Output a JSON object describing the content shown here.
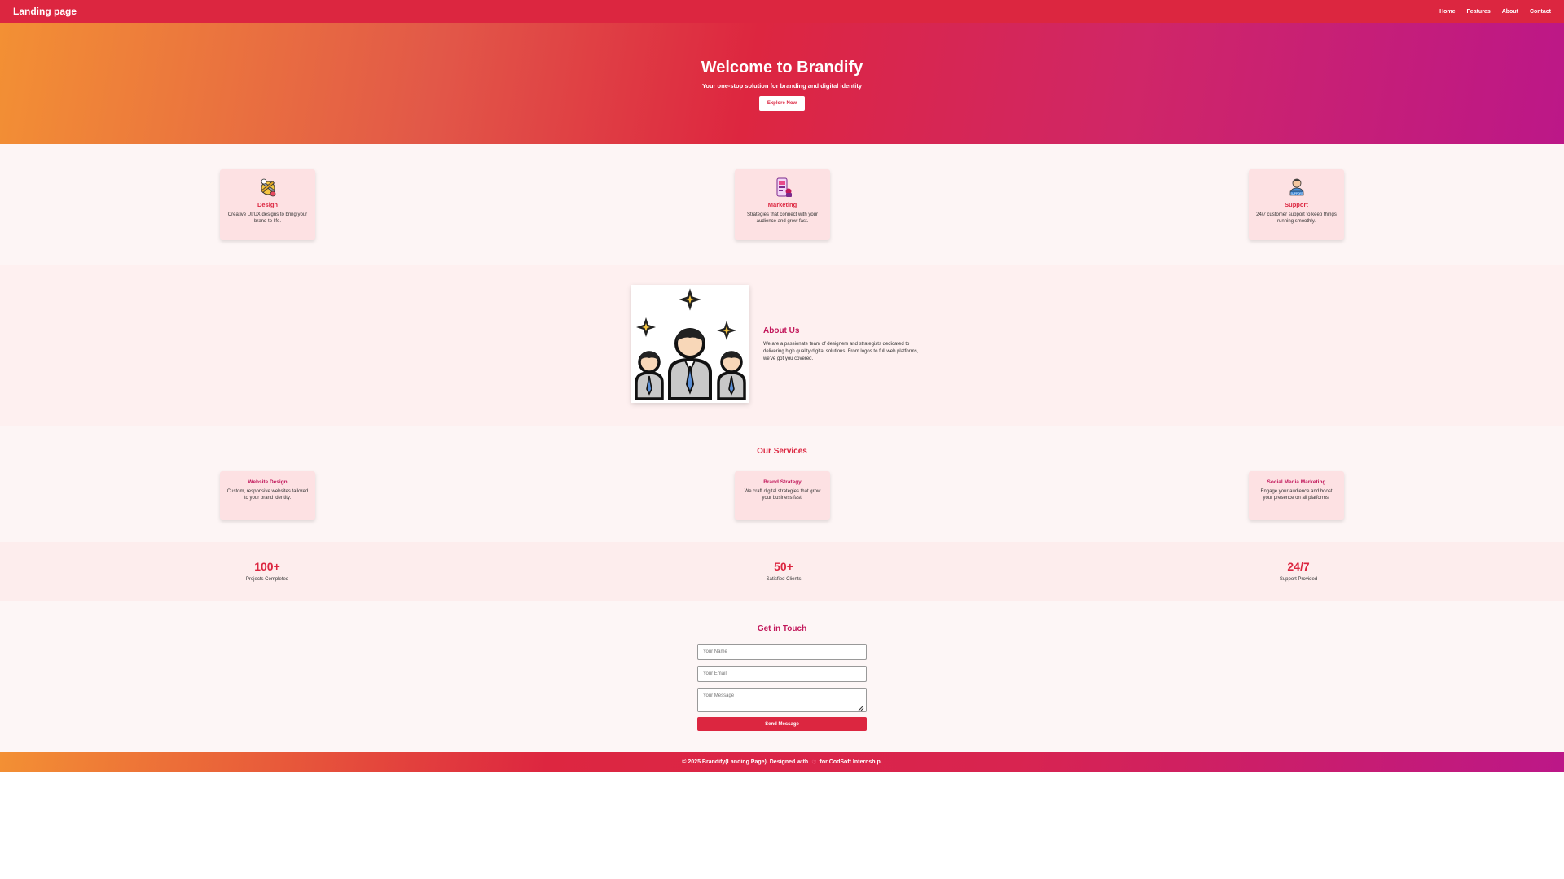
{
  "navbar": {
    "brand": "Landing page",
    "links": [
      "Home",
      "Features",
      "About",
      "Contact"
    ]
  },
  "hero": {
    "title": "Welcome to Brandify",
    "subtitle": "Your one-stop solution for branding and digital identity",
    "cta": "Explore Now"
  },
  "features": [
    {
      "title": "Design",
      "text": "Creative UI/UX designs to bring your brand to life.",
      "icon": "design-tools-icon"
    },
    {
      "title": "Marketing",
      "text": "Strategies that connect with your audience and grow fast.",
      "icon": "marketing-phone-icon"
    },
    {
      "title": "Support",
      "text": "24/7 customer support to keep things running smoothly.",
      "icon": "support-agent-icon"
    }
  ],
  "about": {
    "title": "About Us",
    "text": "We are a passionate team of designers and strategists dedicated to delivering high quality digital solutions. From logos to full web platforms, we've got you covered.",
    "image": "team-illustration"
  },
  "services": {
    "title": "Our Services",
    "items": [
      {
        "title": "Website Design",
        "text": "Custom, responsive websites tailored to your brand identity."
      },
      {
        "title": "Brand Strategy",
        "text": "We craft digital strategies that grow your business fast."
      },
      {
        "title": "Social Media Marketing",
        "text": "Engage your audience and boost your presence on all platforms."
      }
    ]
  },
  "stats": [
    {
      "value": "100+",
      "label": "Projects Completed"
    },
    {
      "value": "50+",
      "label": "Satisfied Clients"
    },
    {
      "value": "24/7",
      "label": "Support Provided"
    }
  ],
  "contact": {
    "title": "Get in Touch",
    "name_placeholder": "Your Name",
    "email_placeholder": "Your Email",
    "message_placeholder": "Your Message",
    "submit": "Send Message"
  },
  "footer": {
    "before": "© 2025 Brandify(Landing Page). Designed with",
    "heart": "♡",
    "after": "for CodSoft Internship."
  },
  "colors": {
    "primary": "#dc2640",
    "accent": "#c2185b",
    "card_bg": "#fde1e3",
    "gradient_start": "#f39034",
    "gradient_end": "#bc1788"
  }
}
